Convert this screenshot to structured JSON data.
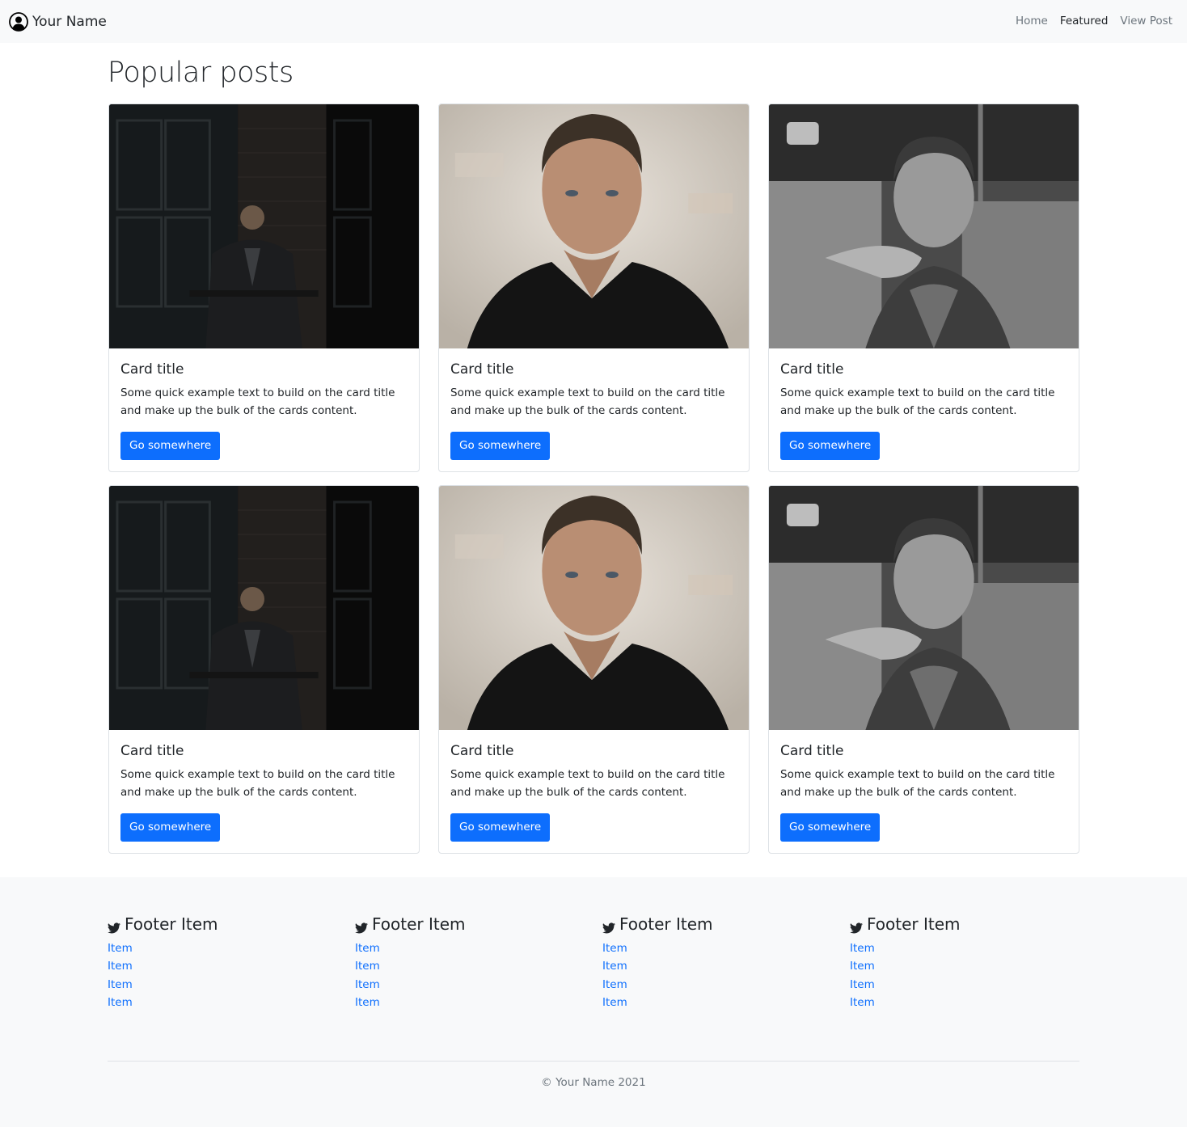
{
  "navbar": {
    "brand": "Your Name",
    "links": [
      {
        "label": "Home",
        "active": false
      },
      {
        "label": "Featured",
        "active": true
      },
      {
        "label": "View Post",
        "active": false
      }
    ]
  },
  "main": {
    "title": "Popular posts",
    "cards": [
      {
        "photo": "dark-window-portrait",
        "title": "Card title",
        "text": "Some quick example text to build on the card title and make up the bulk of the cards content.",
        "button": "Go somewhere"
      },
      {
        "photo": "closeup-portrait",
        "title": "Card title",
        "text": "Some quick example text to build on the card title and make up the bulk of the cards content.",
        "button": "Go somewhere"
      },
      {
        "photo": "bw-thinking-portrait",
        "title": "Card title",
        "text": "Some quick example text to build on the card title and make up the bulk of the cards content.",
        "button": "Go somewhere"
      },
      {
        "photo": "dark-window-portrait",
        "title": "Card title",
        "text": "Some quick example text to build on the card title and make up the bulk of the cards content.",
        "button": "Go somewhere"
      },
      {
        "photo": "closeup-portrait",
        "title": "Card title",
        "text": "Some quick example text to build on the card title and make up the bulk of the cards content.",
        "button": "Go somewhere"
      },
      {
        "photo": "bw-thinking-portrait",
        "title": "Card title",
        "text": "Some quick example text to build on the card title and make up the bulk of the cards content.",
        "button": "Go somewhere"
      }
    ]
  },
  "footer": {
    "columns": [
      {
        "icon": "twitter-icon",
        "heading": "Footer Item",
        "items": [
          "Item",
          "Item",
          "Item",
          "Item"
        ]
      },
      {
        "icon": "twitter-icon",
        "heading": "Footer Item",
        "items": [
          "Item",
          "Item",
          "Item",
          "Item"
        ]
      },
      {
        "icon": "twitter-icon",
        "heading": "Footer Item",
        "items": [
          "Item",
          "Item",
          "Item",
          "Item"
        ]
      },
      {
        "icon": "twitter-icon",
        "heading": "Footer Item",
        "items": [
          "Item",
          "Item",
          "Item",
          "Item"
        ]
      }
    ],
    "copyright": "© Your Name 2021"
  },
  "colors": {
    "primary": "#0d6efd",
    "navbar_bg": "#f8f9fa",
    "muted": "#6c757d",
    "text": "#212529"
  }
}
